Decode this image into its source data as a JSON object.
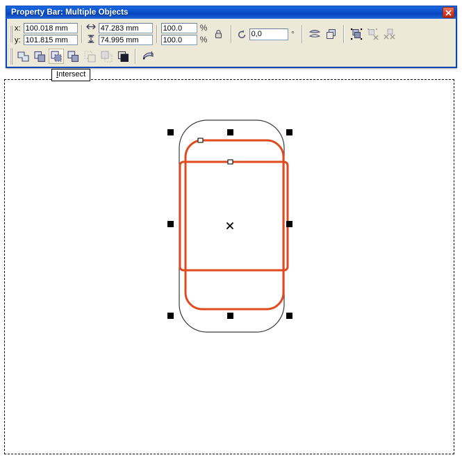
{
  "window": {
    "title": "Property Bar: Multiple Objects",
    "close_label": "Close",
    "close_icon": "close-x-icon"
  },
  "property_bar": {
    "position": {
      "x_label": "x:",
      "x_value": "100.018 mm",
      "y_label": "y:",
      "y_value": "101.815 mm"
    },
    "size": {
      "width_icon": "horizontal-size-icon",
      "width_value": "47.283 mm",
      "height_icon": "vertical-size-icon",
      "height_value": "74.995 mm"
    },
    "scale": {
      "h_value": "100.0",
      "v_value": "100.0",
      "h_unit": "%",
      "v_unit": "%",
      "lock_icon": "lock-ratio-icon",
      "lock_title": "Nonproportional Scaling/Sizing Ratio"
    },
    "rotation": {
      "icon": "rotation-angle-icon",
      "value": "0,0",
      "unit": "°"
    },
    "mirror": {
      "horizontal_icon": "mirror-horizontal-icon",
      "vertical_icon": "mirror-vertical-icon"
    },
    "order": {
      "to_front_icon": "order-to-front-icon"
    },
    "group": {
      "group_icon": "group-icon",
      "ungroup_icon": "ungroup-icon",
      "ungroup_all_icon": "ungroup-all-icon"
    },
    "shaping": [
      {
        "name": "weld",
        "icon": "weld-icon",
        "label": "Weld",
        "state": "normal"
      },
      {
        "name": "trim",
        "icon": "trim-icon",
        "label": "Trim",
        "state": "normal"
      },
      {
        "name": "intersect",
        "icon": "intersect-icon",
        "label": "Intersect",
        "state": "active"
      },
      {
        "name": "simplify",
        "icon": "simplify-icon",
        "label": "Simplify",
        "state": "normal"
      },
      {
        "name": "front-minus-back",
        "icon": "front-minus-back-icon",
        "label": "Front Minus Back",
        "state": "disabled"
      },
      {
        "name": "back-minus-front",
        "icon": "back-minus-front-icon",
        "label": "Back Minus Front",
        "state": "disabled"
      },
      {
        "name": "boundary",
        "icon": "boundary-icon",
        "label": "Create Boundary",
        "state": "normal"
      }
    ],
    "convert": {
      "icon": "convert-to-curves-icon",
      "label": "Convert To Curves"
    }
  },
  "tooltip": {
    "prefix": "",
    "accel": "I",
    "rest": "ntersect",
    "text": "Intersect"
  },
  "canvas": {
    "page_border": "dashed",
    "center_marker": "selection-center-x",
    "handle_count": 8,
    "colors": {
      "orange_stroke": "#e04a1e",
      "black_stroke": "#3a3a3a",
      "handle": "#000000",
      "node_fill": "#ffffff",
      "page_bg": "#ffffff"
    },
    "objects": [
      {
        "name": "base-rounded-rectangle",
        "stroke": "#3a3a3a",
        "selected": false
      },
      {
        "name": "orange-rounded-rectangle-1",
        "stroke": "#e04a1e",
        "selected": true
      },
      {
        "name": "orange-rounded-rectangle-2",
        "stroke": "#e04a1e",
        "selected": true
      }
    ]
  }
}
